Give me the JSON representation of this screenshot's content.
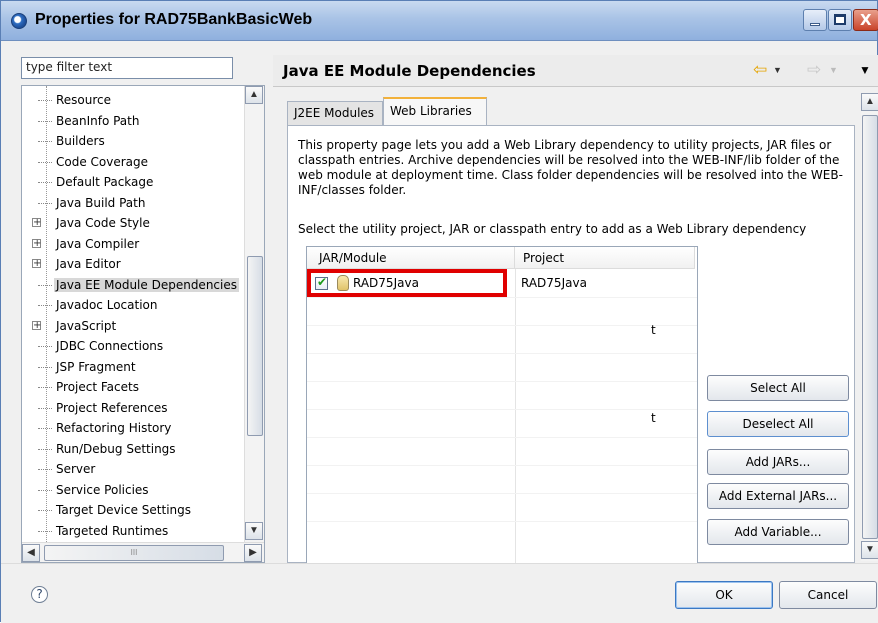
{
  "window": {
    "title": "Properties for RAD75BankBasicWeb",
    "close_glyph": "X"
  },
  "filter": {
    "value": "type filter text"
  },
  "tree": {
    "items": [
      {
        "label": "Resource",
        "expandable": false
      },
      {
        "label": "BeanInfo Path",
        "expandable": false
      },
      {
        "label": "Builders",
        "expandable": false
      },
      {
        "label": "Code Coverage",
        "expandable": false
      },
      {
        "label": "Default Package",
        "expandable": false
      },
      {
        "label": "Java Build Path",
        "expandable": false
      },
      {
        "label": "Java Code Style",
        "expandable": true
      },
      {
        "label": "Java Compiler",
        "expandable": true
      },
      {
        "label": "Java Editor",
        "expandable": true
      },
      {
        "label": "Java EE Module Dependencies",
        "expandable": false,
        "selected": true
      },
      {
        "label": "Javadoc Location",
        "expandable": false
      },
      {
        "label": "JavaScript",
        "expandable": true
      },
      {
        "label": "JDBC Connections",
        "expandable": false
      },
      {
        "label": "JSP Fragment",
        "expandable": false
      },
      {
        "label": "Project Facets",
        "expandable": false
      },
      {
        "label": "Project References",
        "expandable": false
      },
      {
        "label": "Refactoring History",
        "expandable": false
      },
      {
        "label": "Run/Debug Settings",
        "expandable": false
      },
      {
        "label": "Server",
        "expandable": false
      },
      {
        "label": "Service Policies",
        "expandable": false
      },
      {
        "label": "Target Device Settings",
        "expandable": false
      },
      {
        "label": "Targeted Runtimes",
        "expandable": false
      }
    ],
    "expander_glyph": "+"
  },
  "page": {
    "title": "Java EE Module Dependencies",
    "nav_back_glyph": "⇦",
    "nav_fwd_glyph": "⇨",
    "dropdown_glyph": "▼",
    "view_menu_glyph": "▼"
  },
  "tabs": [
    {
      "label": "J2EE Modules",
      "active": false
    },
    {
      "label": "Web Libraries",
      "active": true
    }
  ],
  "panel": {
    "description": "This property page lets you add a Web Library dependency to utility projects, JAR files or classpath entries. Archive dependencies will be resolved into the WEB-INF/lib folder of the web module at deployment time. Class folder dependencies will be resolved into the WEB-INF/classes folder.",
    "select_label": "Select the utility project, JAR or classpath entry to add as a Web Library dependency",
    "table": {
      "columns": [
        "JAR/Module",
        "Project"
      ],
      "rows": [
        {
          "module": "RAD75Java",
          "project": "RAD75Java",
          "checked": true
        }
      ],
      "stray_marks": [
        "t",
        "t"
      ]
    },
    "buttons": {
      "select_all": "Select All",
      "deselect_all": "Deselect All",
      "add_jars": "Add JARs...",
      "add_external_jars": "Add External JARs...",
      "add_variable": "Add Variable..."
    }
  },
  "scroll_glyphs": {
    "up": "▲",
    "down": "▼",
    "left": "◀",
    "right": "▶",
    "grip": "III"
  },
  "footer": {
    "help_glyph": "?",
    "ok": "OK",
    "cancel": "Cancel"
  }
}
